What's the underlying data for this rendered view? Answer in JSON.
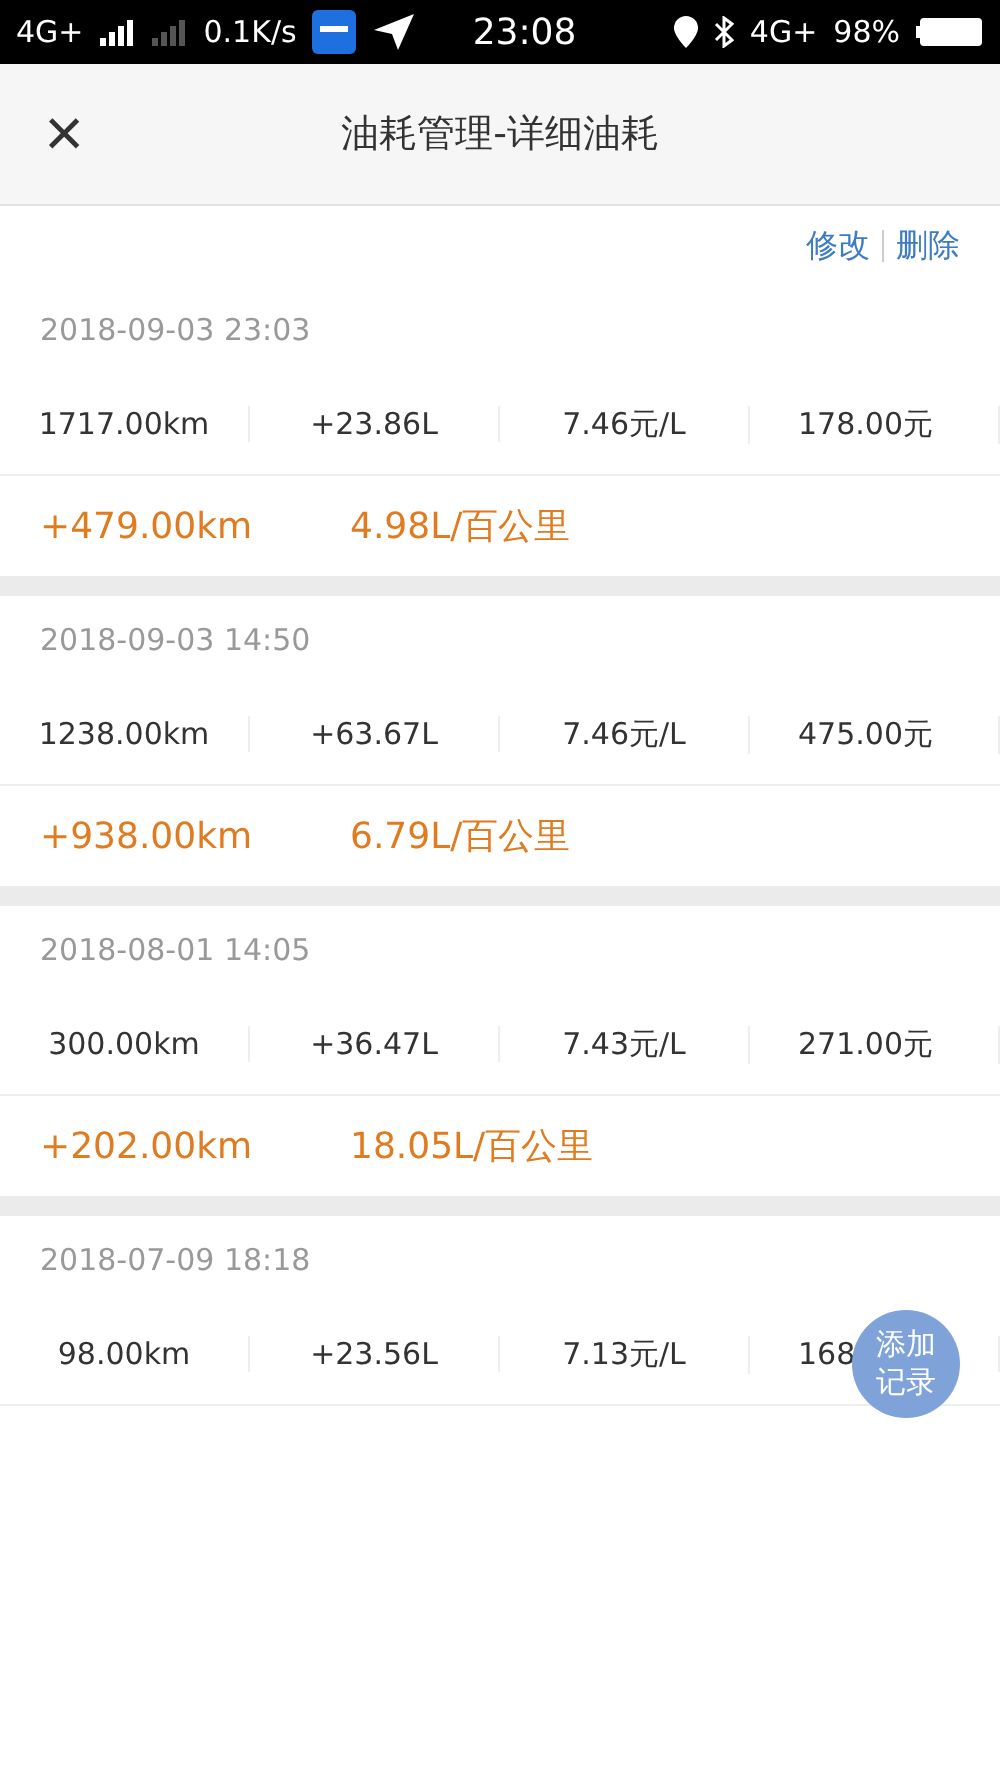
{
  "status_bar": {
    "network": "4G+",
    "speed": "0.1K/s",
    "time": "23:08",
    "network_2": "4G+",
    "battery": "98%"
  },
  "header": {
    "title": "油耗管理-详细油耗",
    "close": "×"
  },
  "actions": [
    "修改",
    "删除"
  ],
  "records": [
    {
      "date": "2018-09-03 23:03",
      "values": [
        "1717.00km",
        "+23.86L",
        "7.46元/L",
        "178.00元"
      ],
      "summary": [
        "+479.00km",
        "4.98L/百公里"
      ]
    },
    {
      "date": "2018-09-03 14:50",
      "values": [
        "1238.00km",
        "+63.67L",
        "7.46元/L",
        "475.00元"
      ],
      "summary": [
        "+938.00km",
        "6.79L/百公里"
      ]
    },
    {
      "date": "2018-08-01 14:05",
      "values": [
        "300.00km",
        "+36.47L",
        "7.43元/L",
        "271.00元"
      ],
      "summary": [
        "+202.00km",
        "18.05L/百公里"
      ]
    },
    {
      "date": "2018-07-09 18:18",
      "values": [
        "98.00km",
        "+23.56L",
        "7.13元/L",
        "168"
      ]
    }
  ],
  "fab": {
    "label": "添加记录"
  }
}
